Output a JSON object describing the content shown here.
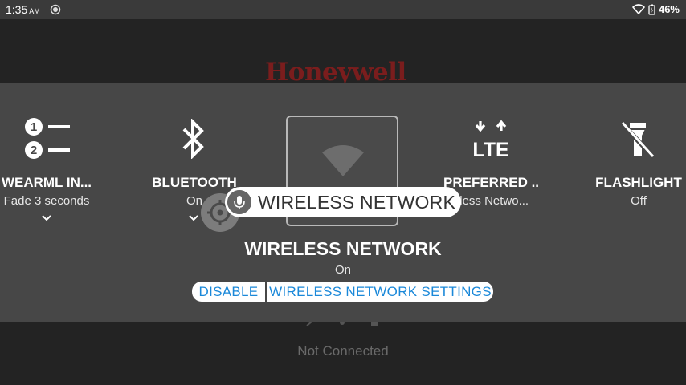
{
  "status_bar": {
    "time": "1:35",
    "ampm": "AM",
    "battery": "46%",
    "icons": [
      "location-icon",
      "wifi-icon",
      "battery-charging-icon"
    ]
  },
  "background": {
    "logo": "Honeywell",
    "status": "Not Connected"
  },
  "quick_tiles": [
    {
      "title": "WEARML IN...",
      "subtitle": "Fade 3 seconds",
      "icon": "numbered-list-icon",
      "expandable": true
    },
    {
      "title": "BLUETOOTH",
      "subtitle": "On",
      "icon": "bluetooth-icon",
      "expandable": true
    },
    {
      "title": "WIRELESS NETWORK",
      "subtitle": "On",
      "icon": "wifi-icon",
      "selected": true
    },
    {
      "title": "PREFERRED ...",
      "subtitle": "eless Netwo...",
      "icon": "lte-icon"
    },
    {
      "title": "FLASHLIGHT",
      "subtitle": "Off",
      "icon": "flashlight-off-icon"
    }
  ],
  "detail": {
    "title": "WIRELESS NETWORK",
    "subtitle": "On",
    "disable_label": "DISABLE",
    "settings_label": "WIRELESS NETWORK SETTINGS"
  },
  "voice_hint": {
    "text": "WIRELESS NETWORK"
  },
  "colors": {
    "accent": "#1a88d9",
    "panel": "#474747",
    "logo": "#7a1d1d"
  }
}
